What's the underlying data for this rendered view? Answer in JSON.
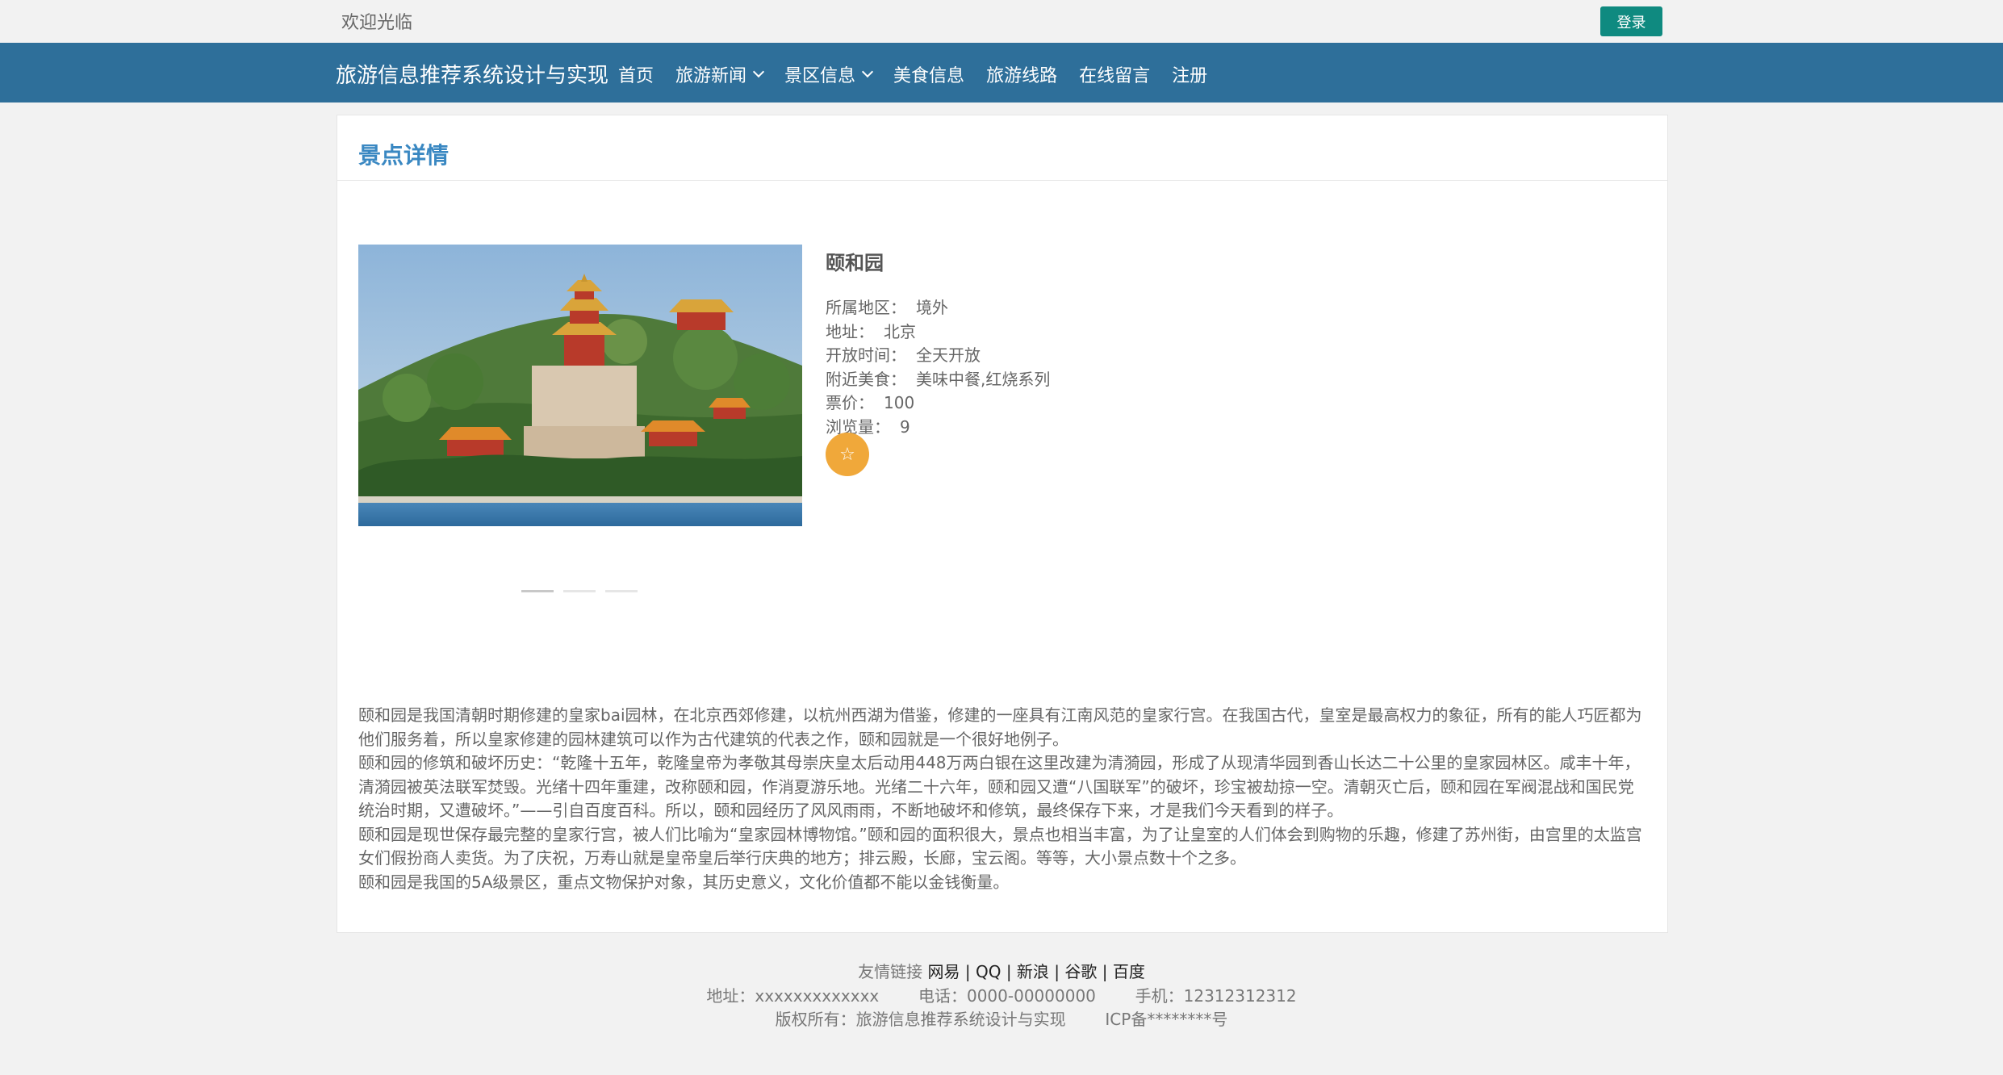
{
  "topbar": {
    "welcome": "欢迎光临",
    "login_label": "登录"
  },
  "nav": {
    "brand": "旅游信息推荐系统设计与实现",
    "items": [
      {
        "label": "首页",
        "has_dropdown": false
      },
      {
        "label": "旅游新闻",
        "has_dropdown": true
      },
      {
        "label": "景区信息",
        "has_dropdown": true
      },
      {
        "label": "美食信息",
        "has_dropdown": false
      },
      {
        "label": "旅游线路",
        "has_dropdown": false
      },
      {
        "label": "在线留言",
        "has_dropdown": false
      },
      {
        "label": "注册",
        "has_dropdown": false
      }
    ]
  },
  "detail": {
    "section_title": "景点详情",
    "name": "颐和园",
    "fields": [
      {
        "label": "所属地区：",
        "value": "境外"
      },
      {
        "label": "地址：",
        "value": "北京"
      },
      {
        "label": "开放时间：",
        "value": "全天开放"
      },
      {
        "label": "附近美食：",
        "value": "美味中餐,红烧系列"
      },
      {
        "label": "票价：",
        "value": "100"
      },
      {
        "label": "浏览量：",
        "value": "9"
      }
    ],
    "favorite_icon": "star-outline-icon",
    "carousel_dots": 3,
    "carousel_active": 0,
    "description": [
      "颐和园是我国清朝时期修建的皇家bai园林，在北京西郊修建，以杭州西湖为借鉴，修建的一座具有江南风范的皇家行宫。在我国古代，皇室是最高权力的象征，所有的能人巧匠都为他们服务着，所以皇家修建的园林建筑可以作为古代建筑的代表之作，颐和园就是一个很好地例子。",
      "颐和园的修筑和破坏历史：“乾隆十五年，乾隆皇帝为孝敬其母崇庆皇太后动用448万两白银在这里改建为清漪园，形成了从现清华园到香山长达二十公里的皇家园林区。咸丰十年，清漪园被英法联军焚毁。光绪十四年重建，改称颐和园，作消夏游乐地。光绪二十六年，颐和园又遭“八国联军”的破坏，珍宝被劫掠一空。清朝灭亡后，颐和园在军阀混战和国民党统治时期，又遭破坏。”——引自百度百科。所以，颐和园经历了风风雨雨，不断地破坏和修筑，最终保存下来，才是我们今天看到的样子。",
      "颐和园是现世保存最完整的皇家行宫，被人们比喻为“皇家园林博物馆。”颐和园的面积很大，景点也相当丰富，为了让皇室的人们体会到购物的乐趣，修建了苏州街，由宫里的太监宫女们假扮商人卖货。为了庆祝，万寿山就是皇帝皇后举行庆典的地方；排云殿，长廊，宝云阁。等等，大小景点数十个之多。",
      "颐和园是我国的5A级景区，重点文物保护对象，其历史意义，文化价值都不能以金钱衡量。"
    ]
  },
  "footer": {
    "links_label": "友情链接",
    "links": [
      "网易",
      "QQ",
      "新浪",
      "谷歌",
      "百度"
    ],
    "address": "地址：xxxxxxxxxxxxx",
    "phone": "电话：0000-00000000",
    "mobile": "手机：12312312312",
    "copyright": "版权所有：旅游信息推荐系统设计与实现",
    "icp": "ICP备********号"
  }
}
